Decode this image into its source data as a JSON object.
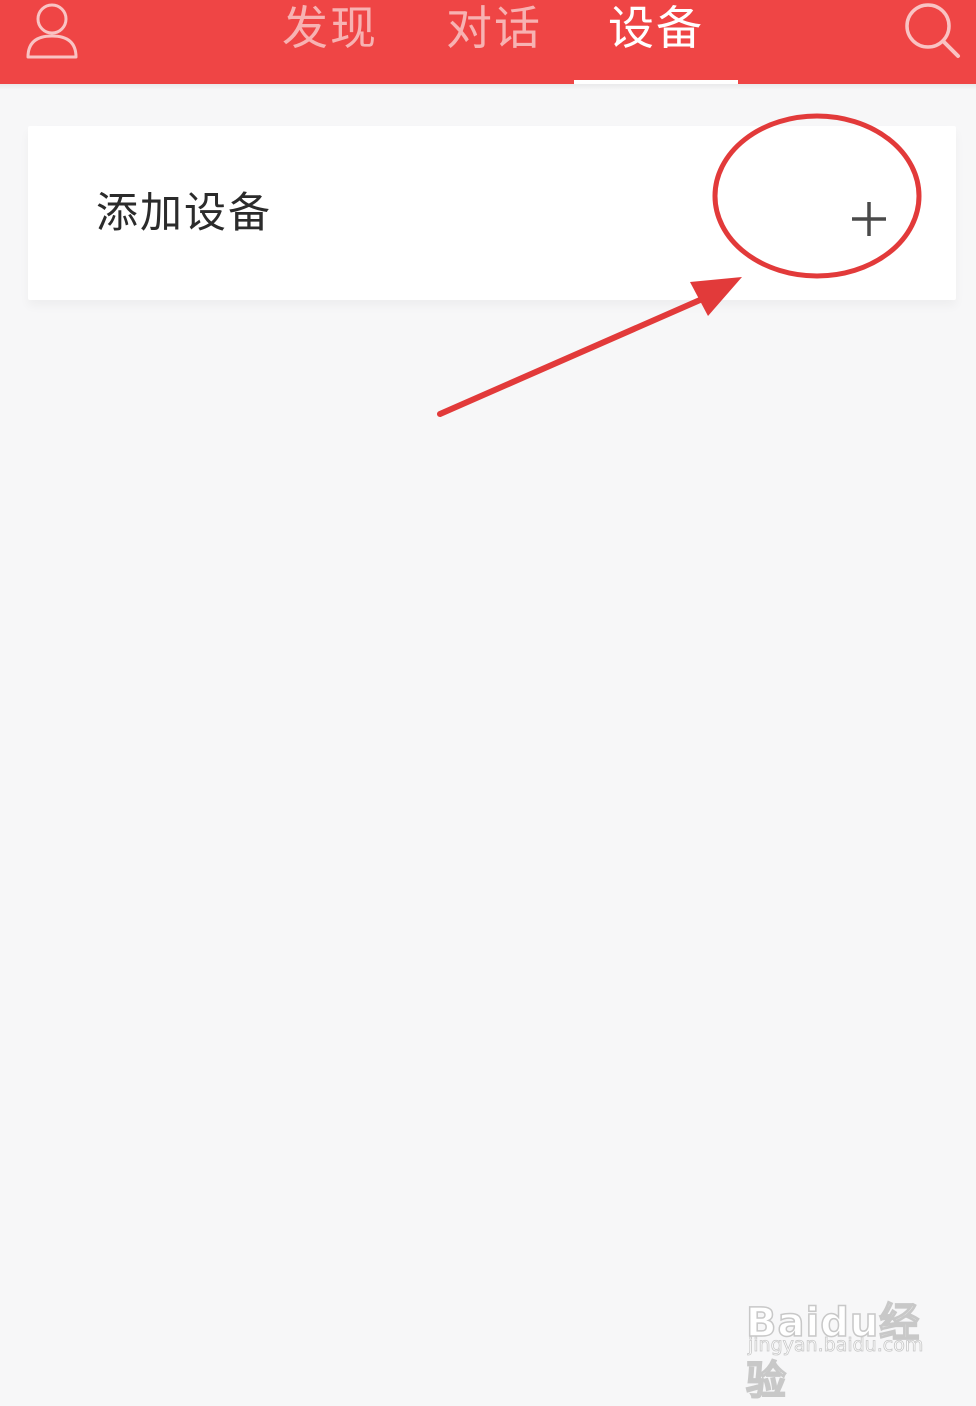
{
  "header": {
    "tabs": [
      {
        "label": "发现",
        "active": false
      },
      {
        "label": "对话",
        "active": false
      },
      {
        "label": "设备",
        "active": true
      }
    ],
    "left_icon": "user-profile-icon",
    "right_icon": "search-icon",
    "bar_color": "#ef4545"
  },
  "main": {
    "add_device_card": {
      "label": "添加设备",
      "action_icon": "plus-icon"
    }
  },
  "annotation": {
    "circle_color": "#e23a3a",
    "arrow_color": "#e23a3a"
  },
  "watermark": {
    "brand": "Baidu经验",
    "url": "jingyan.baidu.com"
  }
}
